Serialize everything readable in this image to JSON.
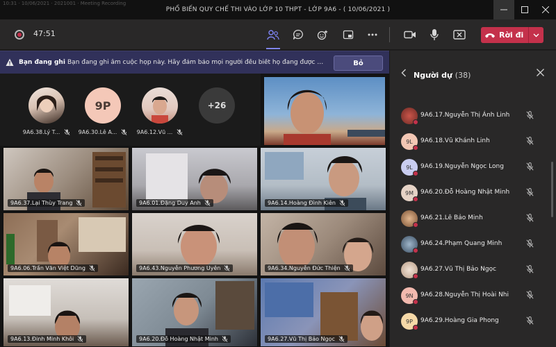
{
  "window": {
    "faint_text": "10:31 · 10/06/2021 · 2021001 · Meeting Recording",
    "title": "PHỔ BIẾN QUY CHẾ THI VÀO LỚP 10 THPT - LỚP 9A6 - ( 10/06/2021 )"
  },
  "toolbar": {
    "timer": "47:51",
    "leave_label": "Rời đi"
  },
  "banner": {
    "title": "Bạn đang ghi",
    "message": "Bạn đang ghi âm cuộc họp này. Hãy đảm bảo mọi người đều biết họ đang được ghi âm.",
    "button": "Bỏ"
  },
  "avatars": [
    {
      "label": "9A6.38.Lý T..."
    },
    {
      "label": "9A6.30.Lê A...",
      "initials": "9P"
    },
    {
      "label": "9A6.12.Vũ ..."
    },
    {
      "label": "",
      "initials": "+26"
    }
  ],
  "tiles": [
    {
      "label": "9A6.37.Lại Thùy Trang"
    },
    {
      "label": "9A6.01.Đặng Duy Anh"
    },
    {
      "label": "9A6.14.Hoàng Đình Kiên"
    },
    {
      "label": "9A6.06.Trần Văn Việt Dũng"
    },
    {
      "label": "9A6.43.Nguyễn Phương Uyên"
    },
    {
      "label": "9A6.34.Nguyễn Đức Thiện"
    },
    {
      "label": "9A6.13.Đinh Minh Khôi"
    },
    {
      "label": "9A6.20.Đỗ Hoàng Nhật Minh"
    },
    {
      "label": "9A6.27.Vũ Thị Bảo Ngọc"
    }
  ],
  "panel": {
    "title": "Người dự",
    "count": "(38)",
    "participants": [
      {
        "name": "9A6.17.Nguyễn Thị Ánh Linh"
      },
      {
        "name": "9A6.18.Vũ Khánh Linh",
        "initials": "9L"
      },
      {
        "name": "9A6.19.Nguyễn Ngọc Long",
        "initials": "9L"
      },
      {
        "name": "9A6.20.Đỗ Hoàng Nhật Minh",
        "initials": "9M"
      },
      {
        "name": "9A6.21.Lê Bảo Minh"
      },
      {
        "name": "9A6.24.Phạm Quang Minh"
      },
      {
        "name": "9A6.27.Vũ Thị Bảo Ngọc"
      },
      {
        "name": "9A6.28.Nguyễn Thị Hoài Nhi",
        "initials": "9N"
      },
      {
        "name": "9A6.29.Hoàng Gia Phong",
        "initials": "9P"
      }
    ]
  },
  "colors": {
    "accent": "#7f85f5",
    "leave": "#c4314b",
    "banner": "#31315a",
    "panel": "#292828"
  }
}
